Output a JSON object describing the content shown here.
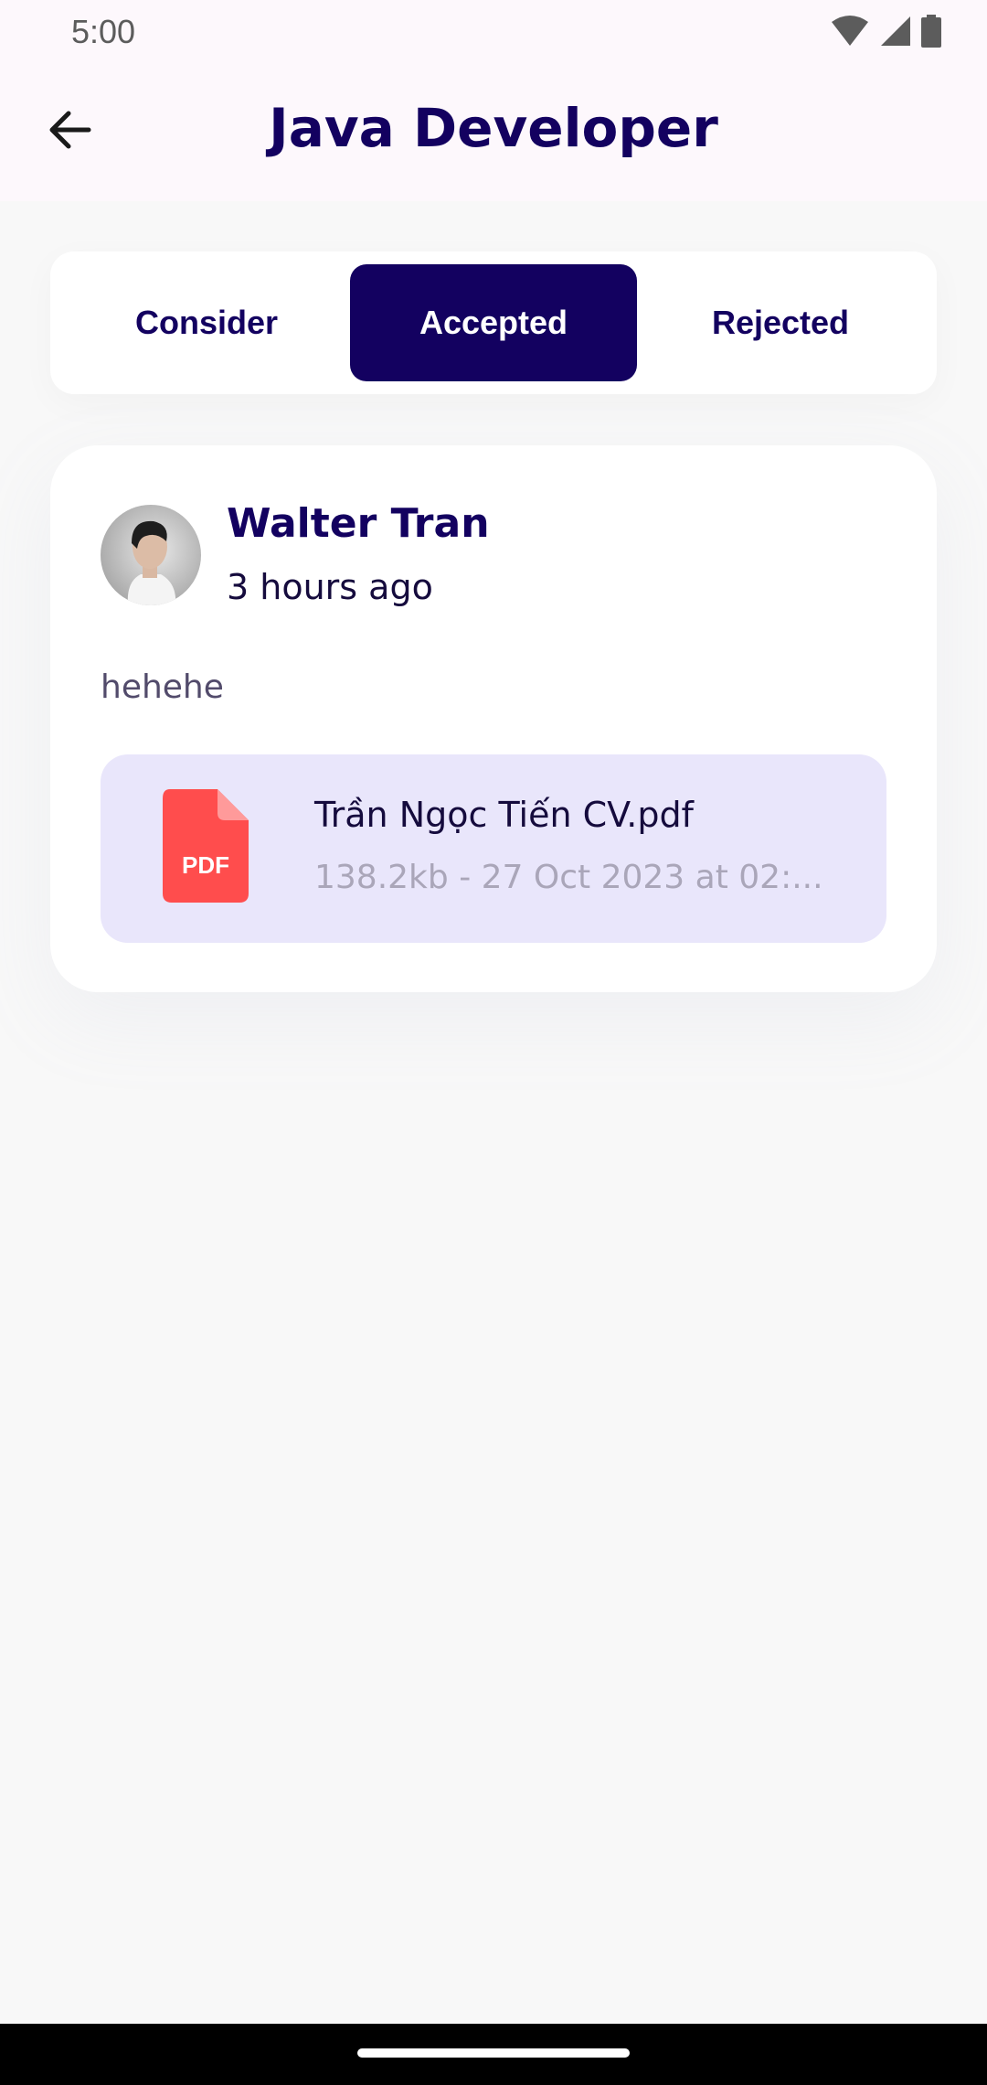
{
  "status_bar": {
    "time": "5:00"
  },
  "header": {
    "title": "Java Developer"
  },
  "tabs": [
    {
      "label": "Consider",
      "active": false
    },
    {
      "label": "Accepted",
      "active": true
    },
    {
      "label": "Rejected",
      "active": false
    }
  ],
  "application": {
    "name": "Walter Tran",
    "time_ago": "3 hours ago",
    "message": "hehehe",
    "attachment": {
      "icon": "pdf-file-icon",
      "icon_label": "PDF",
      "file_name": "Trần Ngọc Tiến CV.pdf",
      "meta": "138.2kb - 27 Oct 2023 at 02:..."
    }
  },
  "colors": {
    "primary": "#130160",
    "pdf_red": "#ff4d4d",
    "file_box_bg": "#e9e6fb"
  }
}
